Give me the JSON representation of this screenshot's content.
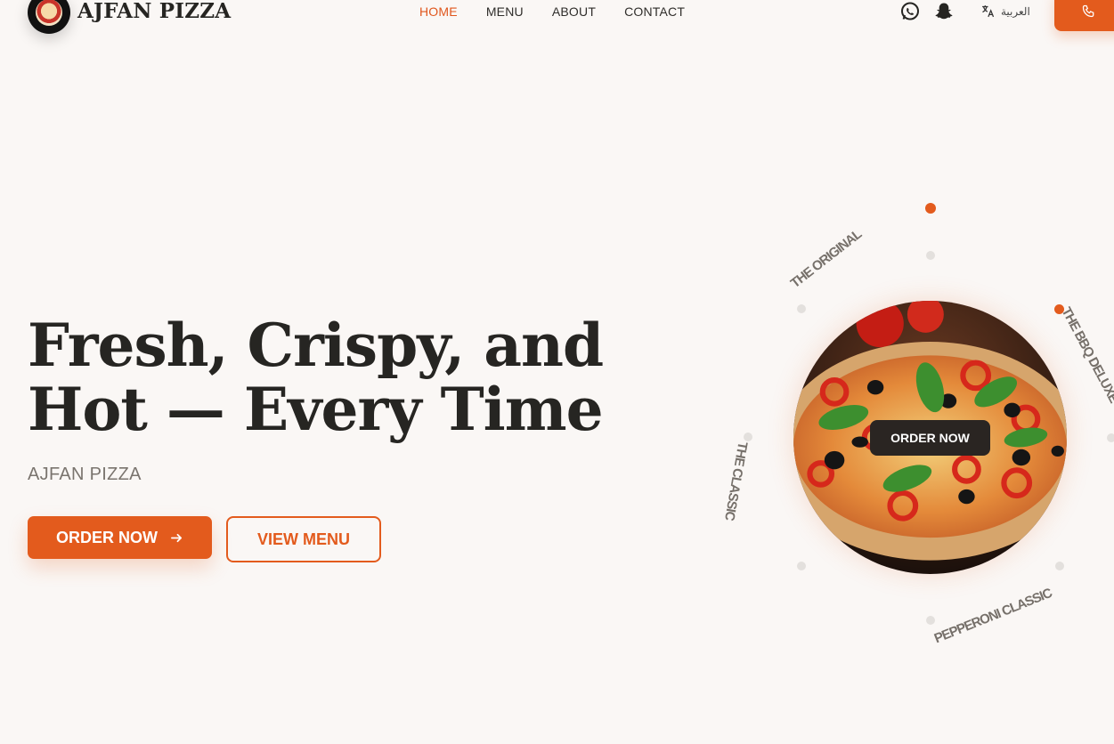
{
  "header": {
    "brand": "AJFAN PIZZA",
    "nav": [
      {
        "label": "HOME",
        "active": true
      },
      {
        "label": "MENU",
        "active": false
      },
      {
        "label": "ABOUT",
        "active": false
      },
      {
        "label": "CONTACT",
        "active": false
      }
    ],
    "social_icons": [
      "whatsapp-icon",
      "snapchat-icon"
    ],
    "language_label": "العربية",
    "language_icon": "translate-icon",
    "phone_icon": "phone-icon"
  },
  "hero": {
    "title_line1": "Fresh, Crispy, and",
    "title_line2": "Hot — Every Time",
    "subtitle": "AJFAN PIZZA",
    "order_button": "ORDER NOW",
    "view_menu_button": "VIEW MENU"
  },
  "carousel": {
    "labels": [
      "THE ORIGINAL",
      "THE BBQ DELUXE",
      "THE CLASSIC",
      "PEPPERONI CLASSIC"
    ],
    "order_button": "ORDER NOW"
  },
  "colors": {
    "accent": "#e35b1d",
    "background": "#faf7f5",
    "text": "#262522",
    "dark_button": "#2a2522"
  }
}
